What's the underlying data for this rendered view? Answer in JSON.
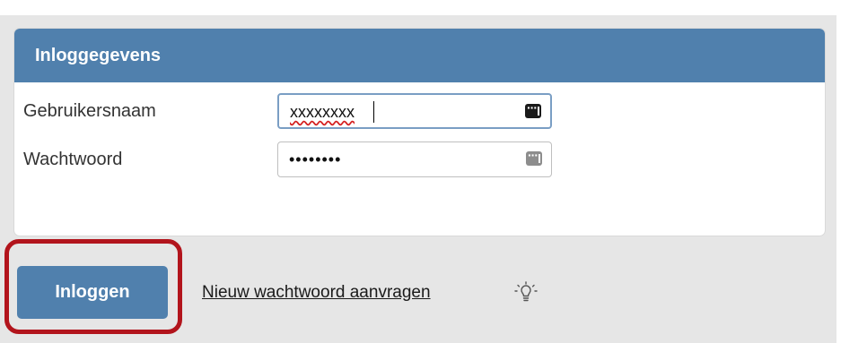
{
  "panel": {
    "title": "Inloggegevens"
  },
  "form": {
    "username": {
      "label": "Gebruikersnaam",
      "value": "xxxxxxxx"
    },
    "password": {
      "label": "Wachtwoord",
      "value": "••••••••"
    }
  },
  "actions": {
    "login_label": "Inloggen",
    "forgot_password_label": "Nieuw wachtwoord aanvragen"
  },
  "icons": {
    "password_manager": "password-manager-key-icon",
    "tip": "lightbulb-icon"
  },
  "colors": {
    "header_blue": "#5080ad",
    "highlight_red": "#b2141c",
    "background_gray": "#e6e6e6"
  }
}
